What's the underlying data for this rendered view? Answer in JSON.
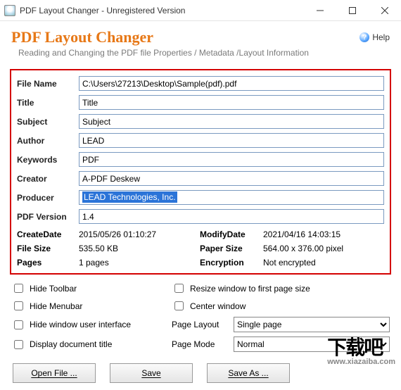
{
  "window": {
    "title": "PDF Layout Changer - Unregistered Version"
  },
  "header": {
    "appTitle": "PDF Layout Changer",
    "helpLabel": "Help",
    "subtitle": "Reading and Changing the PDF file Properties / Metadata /Layout Information"
  },
  "fields": {
    "fileName": {
      "label": "File Name",
      "value": "C:\\Users\\27213\\Desktop\\Sample(pdf).pdf"
    },
    "title": {
      "label": "Title",
      "value": "Title"
    },
    "subject": {
      "label": "Subject",
      "value": "Subject"
    },
    "author": {
      "label": "Author",
      "value": "LEAD"
    },
    "keywords": {
      "label": "Keywords",
      "value": "PDF"
    },
    "creator": {
      "label": "Creator",
      "value": "A-PDF Deskew"
    },
    "producer": {
      "label": "Producer",
      "value": "LEAD Technologies, Inc."
    },
    "pdfVersion": {
      "label": "PDF Version",
      "value": "1.4"
    }
  },
  "info": {
    "createDate": {
      "label": "CreateDate",
      "value": "2015/05/26 01:10:27"
    },
    "modifyDate": {
      "label": "ModifyDate",
      "value": "2021/04/16 14:03:15"
    },
    "fileSize": {
      "label": "File Size",
      "value": "535.50 KB"
    },
    "paperSize": {
      "label": "Paper Size",
      "value": "564.00 x 376.00 pixel"
    },
    "pages": {
      "label": "Pages",
      "value": "1 pages"
    },
    "encryption": {
      "label": "Encryption",
      "value": "Not encrypted"
    }
  },
  "options": {
    "hideToolbar": {
      "label": "Hide Toolbar",
      "checked": false
    },
    "hideMenubar": {
      "label": "Hide Menubar",
      "checked": false
    },
    "hideWindowUI": {
      "label": "Hide window user interface",
      "checked": false
    },
    "displayDocTitle": {
      "label": "Display document title",
      "checked": false
    },
    "resizeWindow": {
      "label": "Resize window to first page size",
      "checked": false
    },
    "centerWindow": {
      "label": "Center window",
      "checked": false
    },
    "pageLayout": {
      "label": "Page Layout",
      "value": "Single page"
    },
    "pageMode": {
      "label": "Page Mode",
      "value": "Normal"
    }
  },
  "buttons": {
    "openFile": "Open File ...",
    "save": "Save",
    "saveAs": "Save As ..."
  },
  "watermark": {
    "text": "下载吧",
    "url": "www.xiazaiba.com"
  }
}
